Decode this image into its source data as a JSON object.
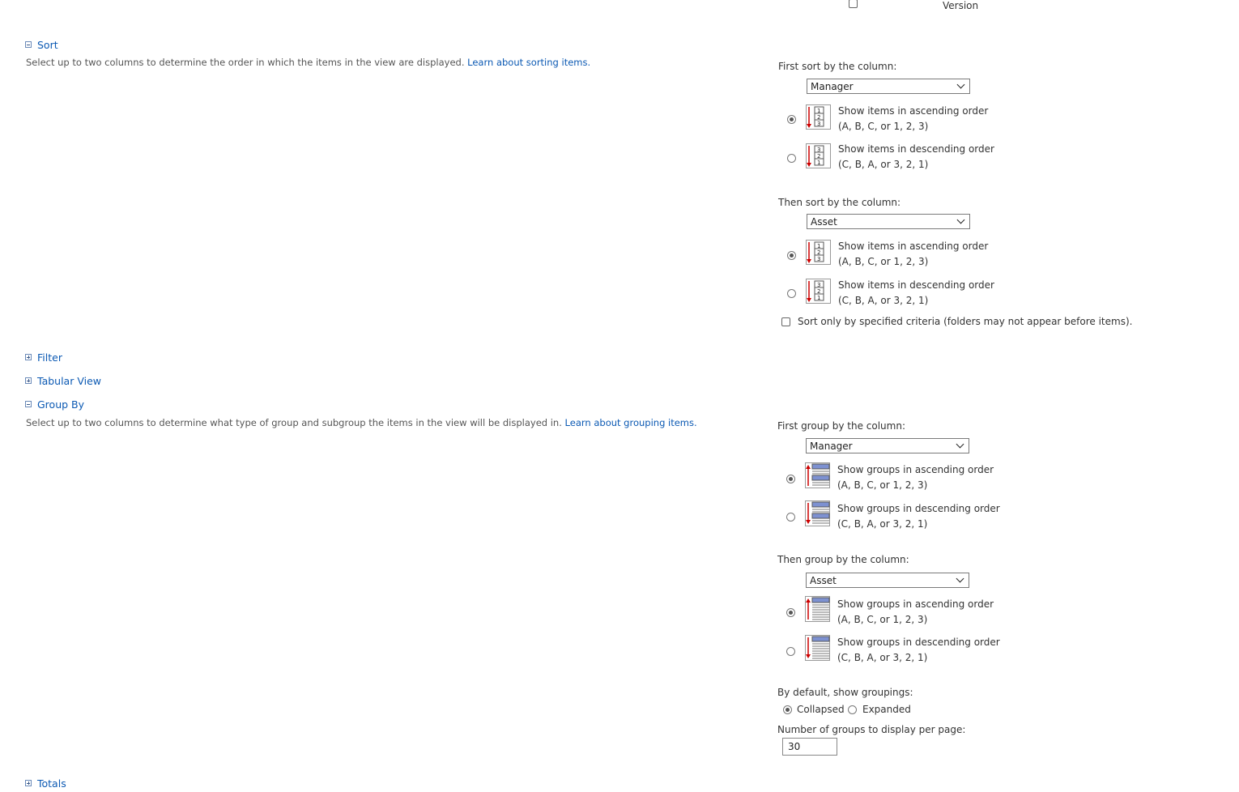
{
  "top": {
    "version_label": "Version"
  },
  "sections": {
    "sort": {
      "title": "Sort",
      "description": "Select up to two columns to determine the order in which the items in the view are displayed.",
      "link": "Learn about sorting items."
    },
    "filter": {
      "title": "Filter"
    },
    "tabular": {
      "title": "Tabular View"
    },
    "group": {
      "title": "Group By",
      "description": "Select up to two columns to determine what type of group and subgroup the items in the view will be displayed in.",
      "link": "Learn about grouping items."
    },
    "totals": {
      "title": "Totals"
    }
  },
  "sort": {
    "first_label": "First sort by the column:",
    "first_value": "Manager",
    "then_label": "Then sort by the column:",
    "then_value": "Asset",
    "asc_line1": "Show items in ascending order",
    "asc_line2": "(A, B, C, or 1, 2, 3)",
    "desc_line1": "Show items in descending order",
    "desc_line2": "(C, B, A, or 3, 2, 1)",
    "criteria_label": "Sort only by specified criteria (folders may not appear before items)."
  },
  "group": {
    "first_label": "First group by the column:",
    "first_value": "Manager",
    "then_label": "Then group by the column:",
    "then_value": "Asset",
    "asc_line1": "Show groups in ascending order",
    "asc_line2": "(A, B, C, or 1, 2, 3)",
    "desc_line1": "Show groups in descending order",
    "desc_line2": "(C, B, A, or 3, 2, 1)",
    "default_label": "By default, show groupings:",
    "collapsed": "Collapsed",
    "expanded": "Expanded",
    "count_label": "Number of groups to display per page:",
    "count_value": "30"
  },
  "icons": {
    "toggle_minus": "collapse-icon",
    "toggle_plus": "expand-icon",
    "accent": "#0b59b3",
    "arrow": "#cc0000",
    "group_bar": "#7d91d1"
  }
}
